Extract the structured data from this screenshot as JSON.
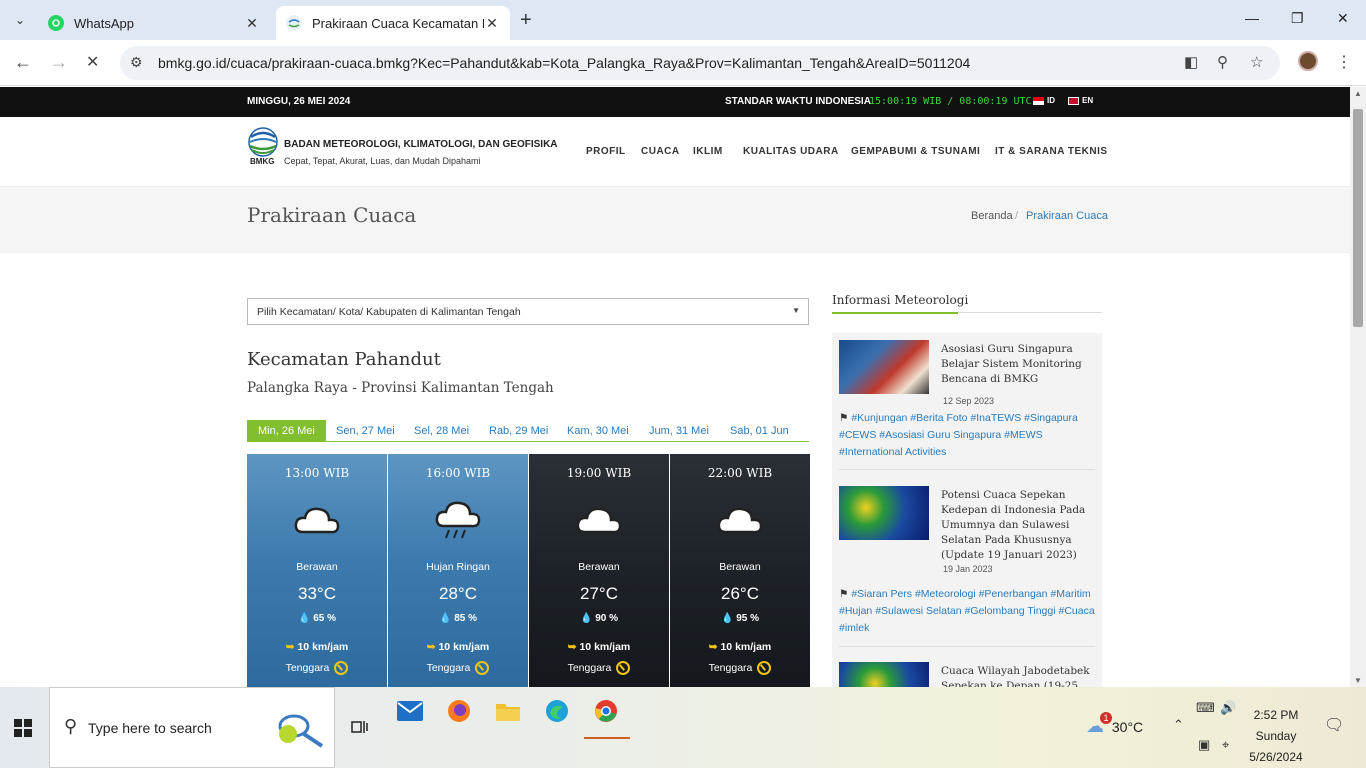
{
  "browser": {
    "tabs": [
      {
        "label": "WhatsApp",
        "icon": "whatsapp-icon"
      },
      {
        "label": "Prakiraan Cuaca Kecamatan Pah",
        "icon": "bmkg-favicon"
      }
    ],
    "url": "bmkg.go.id/cuaca/prakiraan-cuaca.bmkg?Kec=Pahandut&kab=Kota_Palangka_Raya&Prov=Kalimantan_Tengah&AreaID=5011204"
  },
  "topstrip": {
    "date": "MINGGU, 26 MEI 2024",
    "standard": "STANDAR WAKTU INDONESIA",
    "clock": "15:00:19 WIB / 08:00:19 UTC",
    "lang_id": "ID",
    "lang_en": "EN"
  },
  "header": {
    "logo_text": "BMKG",
    "org": "BADAN METEOROLOGI, KLIMATOLOGI, DAN GEOFISIKA",
    "slogan": "Cepat, Tepat, Akurat, Luas, dan Mudah Dipahami",
    "menu": [
      "PROFIL",
      "CUACA",
      "IKLIM",
      "KUALITAS UDARA",
      "GEMPABUMI & TSUNAMI",
      "IT & SARANA TEKNIS"
    ]
  },
  "titlebar": {
    "title": "Prakiraan Cuaca",
    "crumb_home": "Beranda",
    "crumb_sep": "/",
    "crumb_current": "Prakiraan Cuaca"
  },
  "select": {
    "placeholder": "Pilih Kecamatan/ Kota/ Kabupaten di Kalimantan Tengah"
  },
  "location": {
    "kecamatan": "Kecamatan Pahandut",
    "province": "Palangka Raya - Provinsi Kalimantan Tengah"
  },
  "day_tabs": [
    "Min, 26 Mei",
    "Sen, 27 Mei",
    "Sel, 28 Mei",
    "Rab, 29 Mei",
    "Kam, 30 Mei",
    "Jum, 31 Mei",
    "Sab, 01 Jun"
  ],
  "forecast": [
    {
      "time": "13:00 WIB",
      "condition": "Berawan",
      "temp": "33°C",
      "humidity": "65 %",
      "wind": "10 km/jam",
      "direction": "Tenggara",
      "icon": "cloud-icon",
      "theme": "day"
    },
    {
      "time": "16:00 WIB",
      "condition": "Hujan Ringan",
      "temp": "28°C",
      "humidity": "85 %",
      "wind": "10 km/jam",
      "direction": "Tenggara",
      "icon": "rain-cloud-icon",
      "theme": "day"
    },
    {
      "time": "19:00 WIB",
      "condition": "Berawan",
      "temp": "27°C",
      "humidity": "90 %",
      "wind": "10 km/jam",
      "direction": "Tenggara",
      "icon": "cloud-icon",
      "theme": "night"
    },
    {
      "time": "22:00 WIB",
      "condition": "Berawan",
      "temp": "26°C",
      "humidity": "95 %",
      "wind": "10 km/jam",
      "direction": "Tenggara",
      "icon": "cloud-icon",
      "theme": "night"
    }
  ],
  "sidebar": {
    "title": "Informasi Meteorologi",
    "articles": [
      {
        "title": "Asosiasi Guru Singapura Belajar Sistem Monitoring Bencana di BMKG",
        "date": "12 Sep 2023",
        "tags": "#Kunjungan #Berita Foto #InaTEWS #Singapura #CEWS #Asosiasi Guru Singapura #MEWS #International Activities"
      },
      {
        "title": "Potensi Cuaca Sepekan Kedepan di Indonesia Pada Umumnya dan Sulawesi Selatan Pada Khususnya (Update 19 Januari 2023)",
        "date": "19 Jan 2023",
        "tags": "#Siaran Pers #Meteorologi #Penerbangan #Maritim #Hujan #Sulawesi Selatan #Gelombang Tinggi #Cuaca #imlek"
      },
      {
        "title": "Cuaca Wilayah Jabodetabek Sepekan ke Depan (19-25",
        "date": "",
        "tags": ""
      }
    ]
  },
  "taskbar": {
    "search_placeholder": "Type here to search",
    "weather_temp": "30°C",
    "weather_badge": "1",
    "time": "2:52 PM",
    "day": "Sunday",
    "date": "5/26/2024"
  },
  "colors": {
    "accent_green": "#82bf2e",
    "link_blue": "#2a7bbd",
    "clock_green": "#3fd43f"
  }
}
